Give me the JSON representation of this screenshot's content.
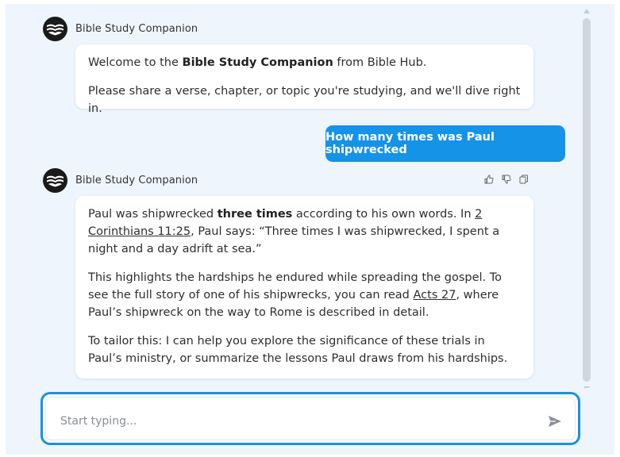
{
  "bot": {
    "name": "Bible Study Companion"
  },
  "welcome": {
    "line1_prefix": "Welcome to the ",
    "line1_bold": "Bible Study Companion",
    "line1_suffix": " from Bible Hub.",
    "line2": "Please share a verse, chapter, or topic you're studying, and we'll dive right in."
  },
  "user_message": "How many times was Paul shipwrecked",
  "answer": {
    "p1_a": "Paul was shipwrecked ",
    "p1_bold": "three times",
    "p1_b": " according to his own words. In ",
    "p1_link": "2 Corinthians 11:25",
    "p1_c": ", Paul says: “Three times I was shipwrecked, I spent a night and a day adrift at sea.”",
    "p2_a": "This highlights the hardships he endured while spreading the gospel. To see the full story of one of his shipwrecks, you can read ",
    "p2_link": "Acts 27",
    "p2_b": ", where Paul’s shipwreck on the way to Rome is described in detail.",
    "p3": "To tailor this: I can help you explore the significance of these trials in Paul’s ministry, or summarize the lessons Paul draws from his hardships."
  },
  "actions": [
    "thumbs-up-icon",
    "thumbs-down-icon",
    "copy-icon"
  ],
  "composer": {
    "placeholder": "Start typing..."
  },
  "colors": {
    "accent": "#1593e6",
    "background": "#eef5fc",
    "card": "#ffffff"
  }
}
